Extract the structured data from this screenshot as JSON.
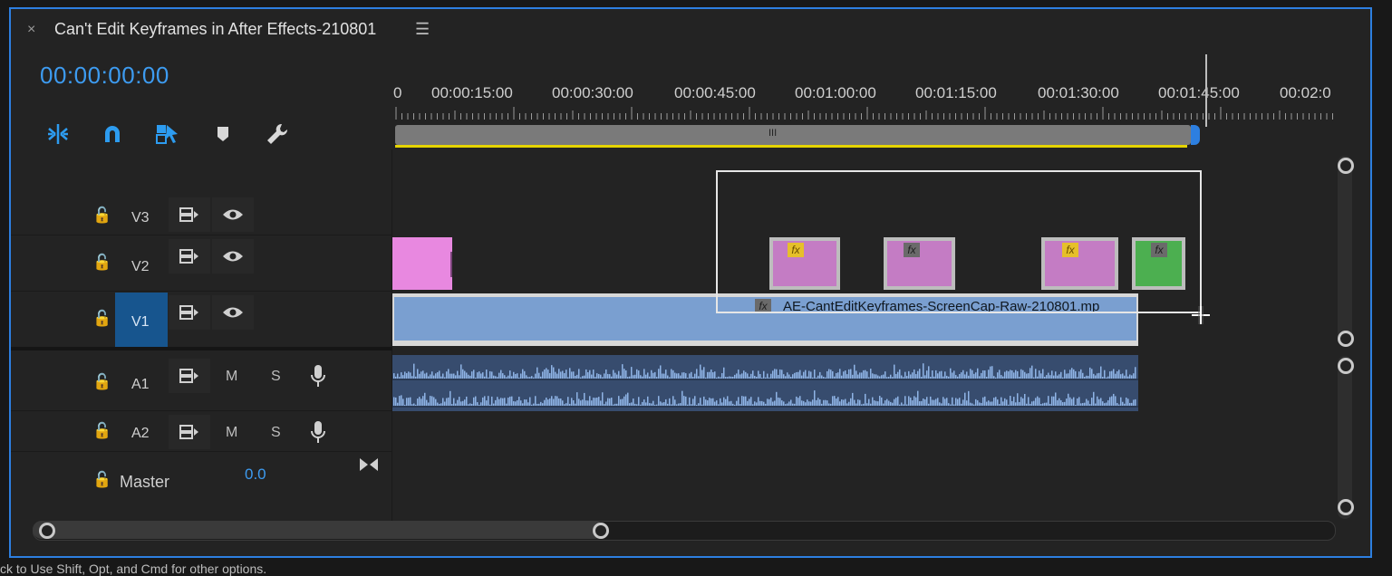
{
  "panel": {
    "close_glyph": "×",
    "title": "Can't Edit Keyframes in After Effects-210801",
    "menu_icon": "hamburger-menu-icon",
    "timecode": "00:00:00:00"
  },
  "tools": [
    {
      "name": "insert-overwrite-sequences-icon",
      "active": true
    },
    {
      "name": "snap-magnet-icon",
      "active": true
    },
    {
      "name": "linked-selection-icon",
      "active": true
    },
    {
      "name": "add-marker-icon",
      "active": false
    },
    {
      "name": "timeline-settings-wrench-icon",
      "active": false
    }
  ],
  "ruler": {
    "labels": [
      "0",
      "00:00:15:00",
      "00:00:30:00",
      "00:00:45:00",
      "00:01:00:00",
      "00:01:15:00",
      "00:01:30:00",
      "00:01:45:00",
      "00:02:0"
    ]
  },
  "zoom": {
    "grip_glyph": "III"
  },
  "tracks": {
    "v3": {
      "name": "V3"
    },
    "v2": {
      "name": "V2"
    },
    "v1": {
      "name": "V1"
    },
    "a1": {
      "name": "A1",
      "mute": "M",
      "solo": "S"
    },
    "a2": {
      "name": "A2",
      "mute": "M",
      "solo": "S"
    },
    "master": {
      "name": "Master",
      "volume": "0.0"
    }
  },
  "clips": {
    "v1_label": "AE-CantEditKeyframes-ScreenCap-Raw-210801.mp",
    "fx_label": "fx"
  },
  "colors": {
    "accent": "#2d7fe0",
    "timecode": "#3d9bf0",
    "video_clip": "#7a9fd0",
    "nested_clip": "#c47cc4",
    "pink_clip": "#e888e0",
    "green_clip": "#4caf50",
    "work_area": "#e5d400",
    "fx_yellow": "#e6c02a"
  },
  "status": {
    "text": "ck to Use Shift, Opt, and Cmd for other options."
  }
}
